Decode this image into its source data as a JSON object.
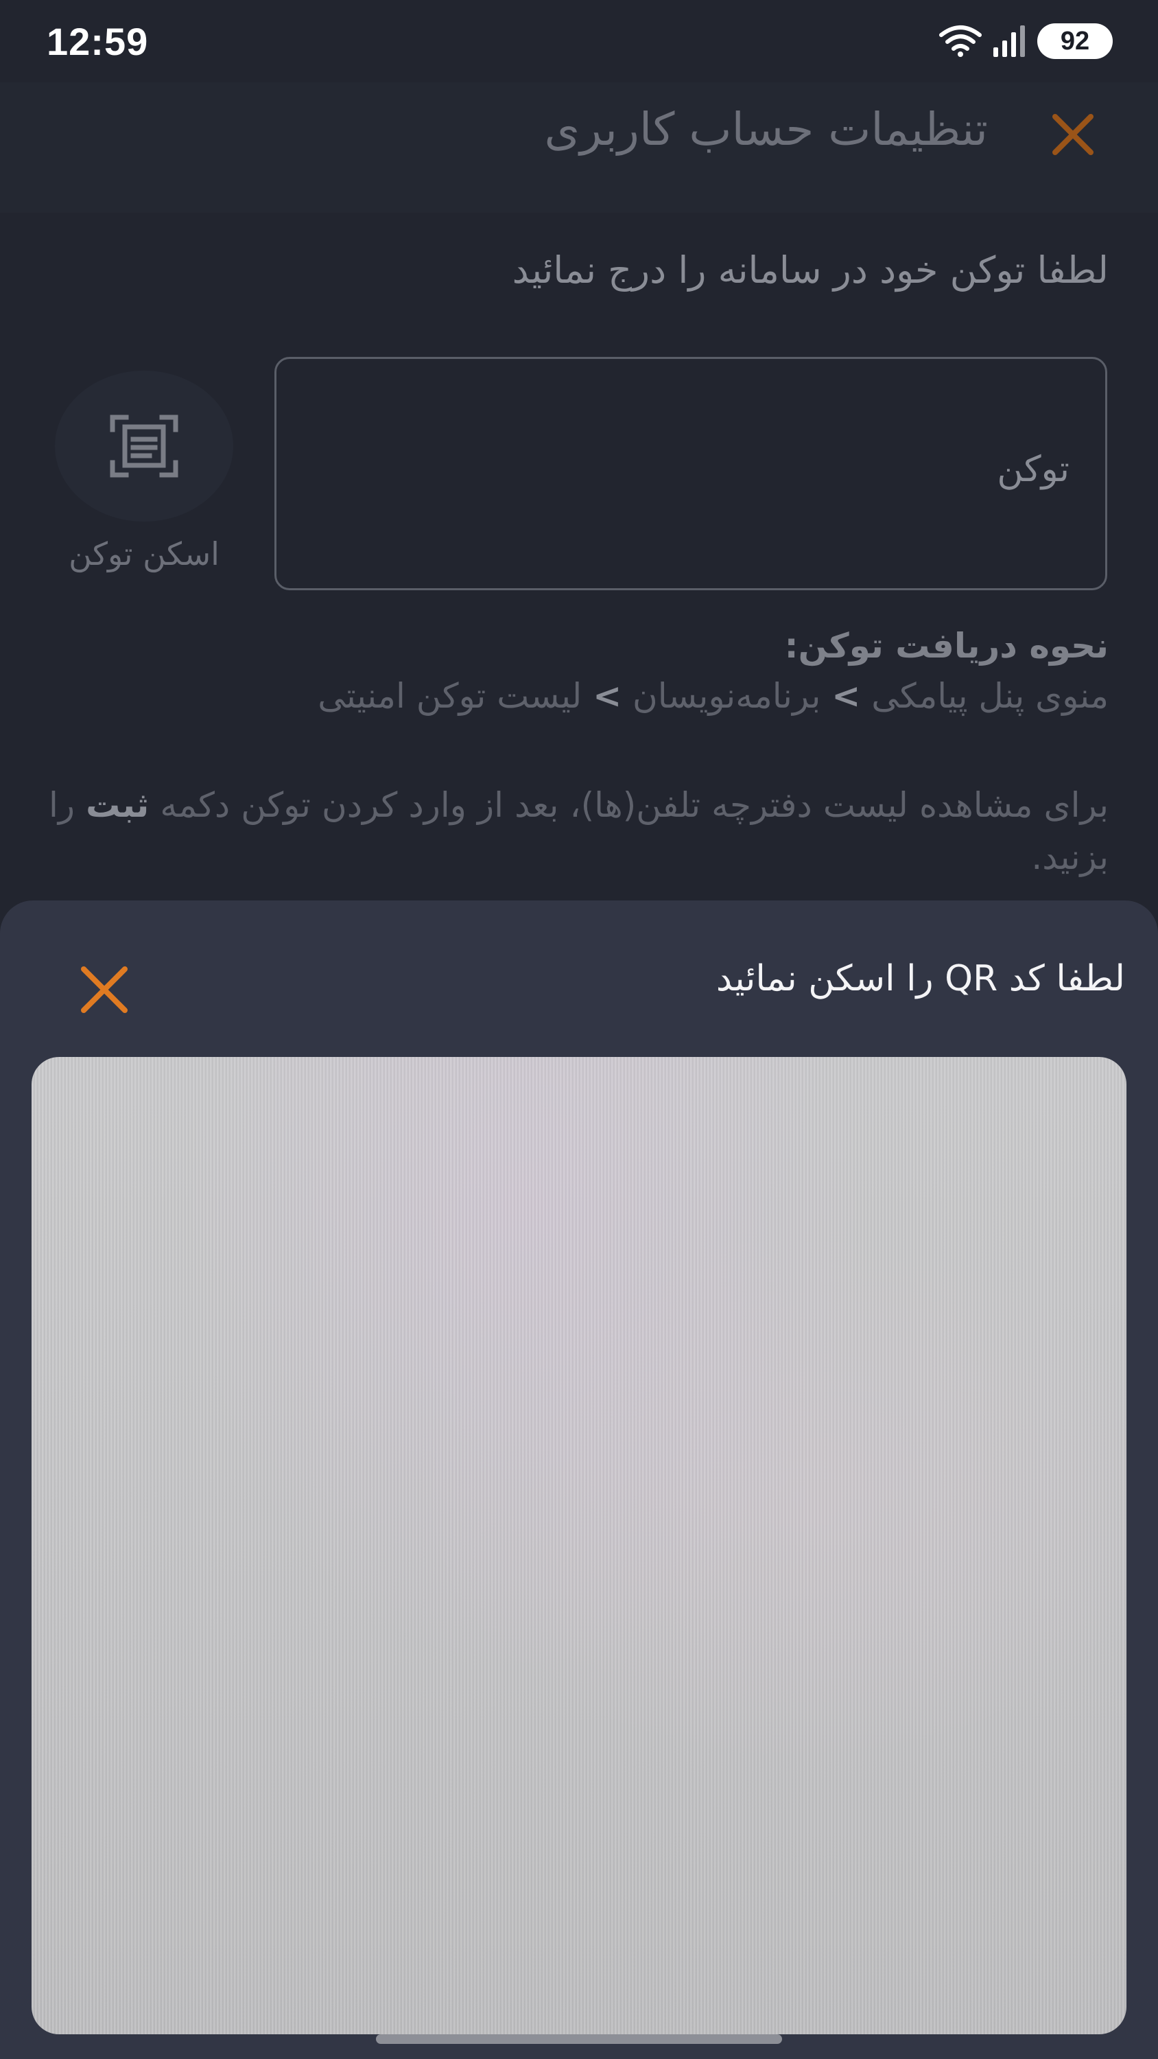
{
  "status_bar": {
    "time": "12:59",
    "battery": "92",
    "icons": [
      "wifi-icon",
      "signal-icon",
      "battery-icon"
    ]
  },
  "header": {
    "title": "تنظیمات حساب کاربری",
    "close_icon": "close-icon"
  },
  "form": {
    "instruction": "لطفا توکن خود در سامانه را درج نمائید",
    "token_placeholder": "توکن",
    "scan_label": "اسکن توکن",
    "scan_icon": "scan-document-icon"
  },
  "howto": {
    "title": "نحوه دریافت توکن:",
    "path": [
      "منوی پنل پیامکی",
      "برنامه‌نویسان",
      "لیست توکن امنیتی"
    ],
    "separator": ">"
  },
  "note": {
    "text_before": "برای مشاهده لیست دفترچه تلفن(ها)، بعد از وارد کردن توکن دکمه",
    "emphasis": "ثبت",
    "text_after": "را بزنید."
  },
  "qr_sheet": {
    "title": "لطفا کد QR را اسکن نمائید",
    "close_icon": "close-icon"
  },
  "colors": {
    "accent": "#e07b22",
    "sheet_bg": "#323645",
    "page_bg": "#22252f"
  }
}
